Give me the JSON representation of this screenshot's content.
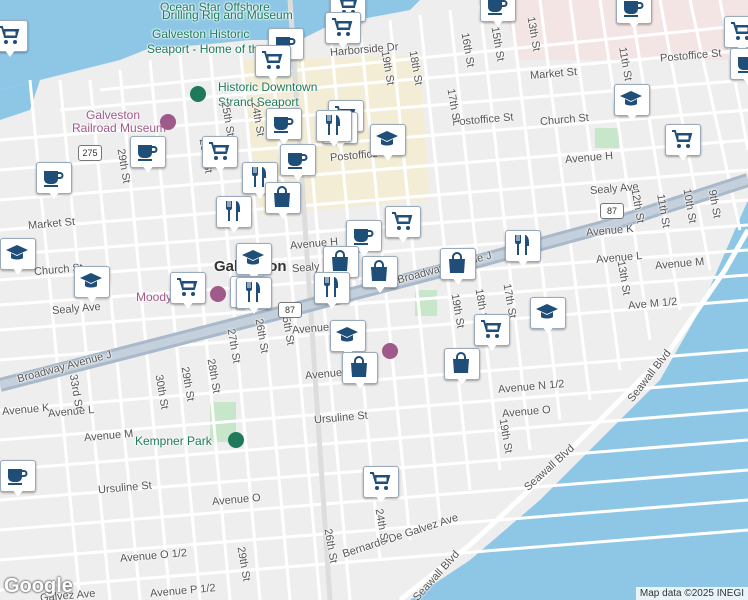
{
  "colors": {
    "water": "#8ec7e6",
    "land": "#eeeeee",
    "road": "#ffffff",
    "highway": "#a9b9c9",
    "park": "#c8e6c9",
    "downtown": "#f8ecc2",
    "marker_icon": "#1f4e79"
  },
  "labels": {
    "ocean_star": "Ocean Star Offshore",
    "drilling_rig": "Drilling Rig and Museum",
    "galveston_historic": "Galveston Historic",
    "seaport_home": "Seaport - Home of the...",
    "historic_downtown": "Historic Downtown",
    "strand_seaport": "Strand Seaport",
    "galveston_rr": "Galveston",
    "railroad_museum": "Railroad Museum",
    "moody": "Moody Ma...",
    "kempner_park": "Kempner Park",
    "galveston_city": "Galveston",
    "harborside": "Harborside Dr",
    "market_st_e": "Market St",
    "market_st_w": "Market St",
    "postoffice_e": "Postoffice St",
    "postoffice_c": "Postoffice",
    "postoffice_ne": "Postoffice St",
    "church_st_e": "Church St",
    "church_st_w": "Church St",
    "avenue_h_e": "Avenue H",
    "avenue_h_c": "Avenue H",
    "sealy_ave_e": "Sealy Ave",
    "sealy_ave_c": "Sealy",
    "sealy_ave_w": "Sealy Ave",
    "avenue_k_e": "Avenue K",
    "avenue_k_w": "Avenue K",
    "avenue_l_e": "Avenue L",
    "avenue_l_w": "Avenue L",
    "avenue_m_e": "Avenue M",
    "avenue_m_w": "Avenue M",
    "ave_m_half": "Ave M 1/2",
    "avenue_m_c": "Avenue",
    "avenue_n_c": "Avenue N",
    "avenue_n_half": "Avenue N 1/2",
    "avenue_o_e": "Avenue O",
    "avenue_o_w": "Avenue O",
    "avenue_o_half": "Avenue O 1/2",
    "avenue_p_half": "Avenue P 1/2",
    "galvez_ave": "Galvez Ave",
    "ursuline_c": "Ursuline St",
    "ursuline_w": "Ursuline St",
    "broadway_w": "Broadway Avenue J",
    "broadway_e": "Broadway Avenue J",
    "bernardo": "Bernardo De Galvez Ave",
    "seawall_1": "Seawall Blvd",
    "seawall_2": "Seawall Blvd",
    "seawall_3": "Seawall Blvd",
    "st_13": "13th St",
    "st_15": "15th St",
    "st_16": "16th St",
    "st_17": "17th St",
    "st_17b": "17th St",
    "st_18": "18th St",
    "st_18b": "18th St",
    "st_19": "19th St",
    "st_19b": "19th St",
    "st_19c": "19th St",
    "st_24": "24th St",
    "st_24b": "24th St",
    "st_25": "25th St",
    "st_25b": "25th St",
    "st_26": "26th St",
    "st_26b": "26th St",
    "st_26c": "26th St",
    "st_27": "27th St",
    "st_28": "28th St",
    "st_29": "29th St",
    "st_29b": "29th St",
    "st_29c": "29th St",
    "st_30": "30th St",
    "st_33": "33rd St",
    "st_11": "11th St",
    "st_12": "12th St",
    "st_10": "10th St",
    "st_9": "9th St",
    "st_11b": "11th St",
    "st_13b": "13th St",
    "shield_275": "275",
    "shield_87_w": "87",
    "shield_87_e": "87"
  },
  "attribution": "Map data ©2025 INEGI",
  "logo": "Google",
  "markers": [
    {
      "icon": "cart"
    },
    {
      "icon": "coffee"
    },
    {
      "icon": "coffee"
    },
    {
      "icon": "cart"
    },
    {
      "icon": "coffee"
    },
    {
      "icon": "cart"
    },
    {
      "icon": "cart"
    },
    {
      "icon": "coffee"
    },
    {
      "icon": "cart"
    },
    {
      "icon": "cart"
    },
    {
      "icon": "coffee"
    },
    {
      "icon": "fork"
    },
    {
      "icon": "coffee"
    },
    {
      "icon": "cart"
    },
    {
      "icon": "coffee"
    },
    {
      "icon": "school"
    },
    {
      "icon": "cart"
    },
    {
      "icon": "coffee"
    },
    {
      "icon": "fork"
    },
    {
      "icon": "bag"
    },
    {
      "icon": "fork"
    },
    {
      "icon": "cart"
    },
    {
      "icon": "coffee"
    },
    {
      "icon": "school"
    },
    {
      "icon": "fork"
    },
    {
      "icon": "bag"
    },
    {
      "icon": "bag"
    },
    {
      "icon": "school"
    },
    {
      "icon": "bag"
    },
    {
      "icon": "fork"
    },
    {
      "icon": "fork"
    },
    {
      "icon": "cart"
    },
    {
      "icon": "fork"
    },
    {
      "icon": "school"
    },
    {
      "icon": "school"
    },
    {
      "icon": "school"
    },
    {
      "icon": "cart"
    },
    {
      "icon": "bag"
    },
    {
      "icon": "bag"
    },
    {
      "icon": "cart"
    },
    {
      "icon": "coffee"
    },
    {
      "icon": "school"
    },
    {
      "icon": "cart"
    }
  ]
}
